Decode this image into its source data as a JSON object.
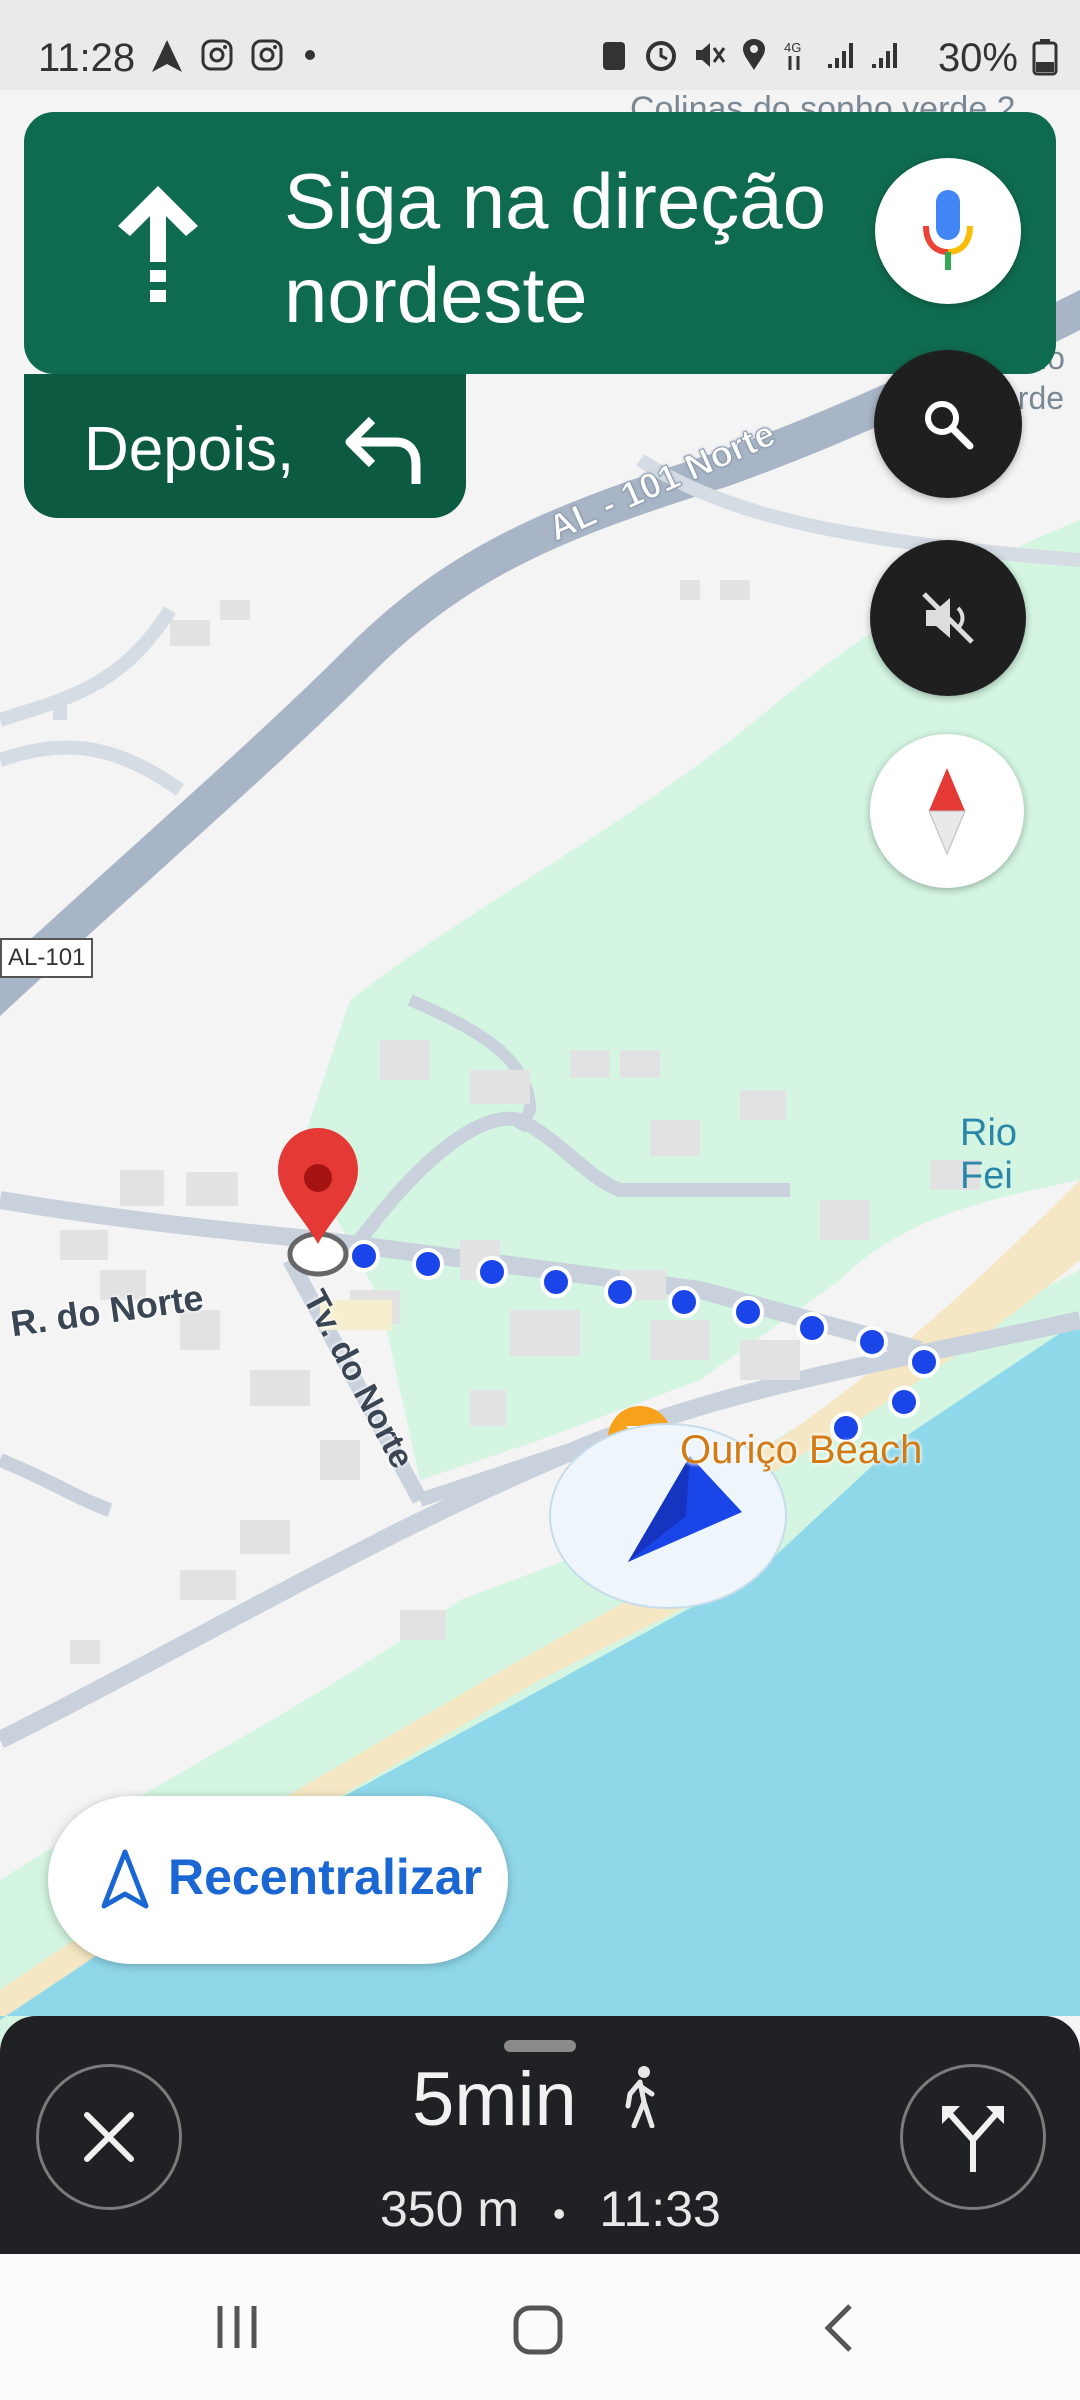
{
  "status_bar": {
    "time": "11:28",
    "battery": "30%"
  },
  "navigation": {
    "instruction": "Siga na direção nordeste",
    "then_label": "Depois,"
  },
  "map": {
    "labels": {
      "top_area": "Colinas do sonho verde 2",
      "top_right_line1": "io",
      "top_right_line2": "erde",
      "highway_name": "AL - 101 Norte",
      "highway_shield": "AL-101",
      "river": "Rio Fei",
      "street1": "R. do Norte",
      "street2": "Tv. do Norte",
      "poi": "Ouriço Beach"
    }
  },
  "recenter_label": "Recentralizar",
  "trip": {
    "eta_duration": "5min",
    "distance": "350 m",
    "arrival_time": "11:33",
    "separator": "•"
  },
  "colors": {
    "nav_green": "#0f6b4f",
    "nav_green_dark": "#0d5a42",
    "route_blue": "#1a45e8",
    "water": "#8fd8ea",
    "park": "#d3f5e1",
    "road": "#a8b5c6",
    "recenter_text": "#1a66d2"
  },
  "icons": [
    "navigation-arrow-icon",
    "instagram-icon",
    "mic-icon",
    "search-icon",
    "mute-icon",
    "compass-icon",
    "recenter-icon",
    "close-icon",
    "alt-routes-icon",
    "walk-icon",
    "recents-icon",
    "home-icon",
    "back-icon",
    "destination-pin-icon"
  ]
}
